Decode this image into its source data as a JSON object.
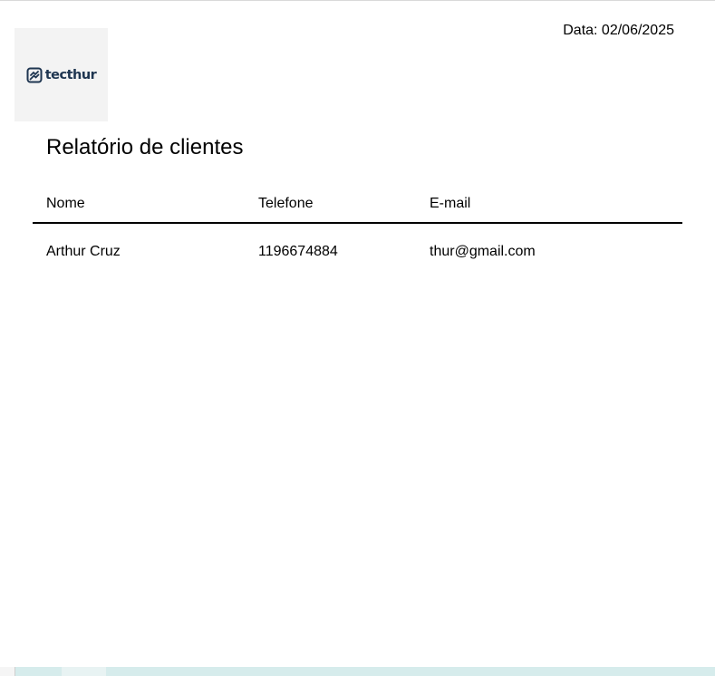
{
  "header": {
    "date_text": "Data: 02/06/2025",
    "logo_text": "tecthur"
  },
  "report": {
    "title": "Relatório de clientes",
    "columns": [
      "Nome",
      "Telefone",
      "E-mail"
    ],
    "rows": [
      {
        "nome": "Arthur Cruz",
        "telefone": "1196674884",
        "email": "thur@gmail.com"
      }
    ]
  },
  "colors": {
    "logo": "#1e3550",
    "logo_bg": "#f3f3f3"
  }
}
